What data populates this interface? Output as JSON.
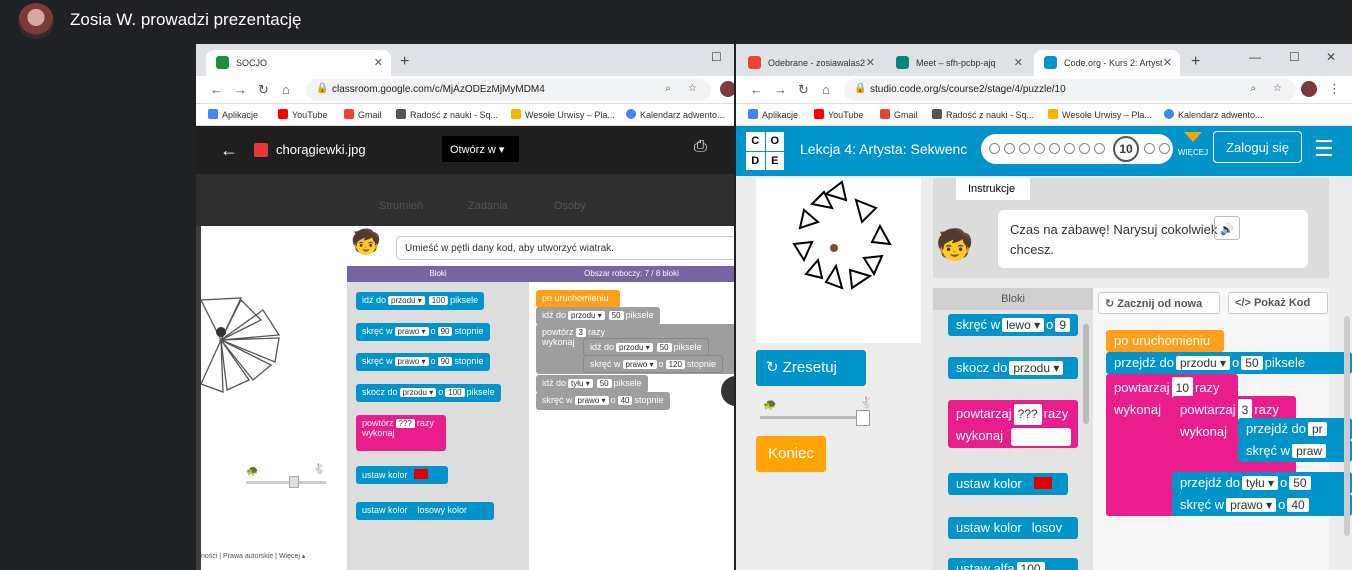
{
  "meet": {
    "presenter_text": "Zosia W. prowadzi prezentację"
  },
  "left_browser": {
    "tab_title": "SOCJO",
    "url": "classroom.google.com/c/MjAzODEzMjMyMDM4",
    "bookmarks": [
      "Aplikacje",
      "YouTube",
      "Gmail",
      "Radość z nauki - Sq...",
      "Wesołe Urwisy – Pla...",
      "Kalendarz adwento..."
    ],
    "viewer": {
      "filename": "chorągiewki.jpg",
      "open_with": "Otwórz w",
      "tabs": [
        "Strumień",
        "Zadania",
        "Osoby"
      ]
    },
    "instruction": "Umieść w pętli dany kod, aby utworzyć wiatrak.",
    "toolbox_header": "Bloki",
    "workspace_header": "Obszar roboczy: 7 / 8 bloki",
    "toolbox_blocks": [
      {
        "pre": "idź do",
        "s1": "przodu ▾",
        "s2": "100",
        "post": "piksele"
      },
      {
        "pre": "skręć w",
        "s1": "prawo ▾",
        "mid": "o",
        "s2": "90",
        "post": "stopnie"
      },
      {
        "pre": "skręć w",
        "s1": "prawo ▾",
        "mid": "o",
        "s2": "90",
        "post": "stopnie"
      },
      {
        "pre": "skocz do",
        "s1": "przodu ▾",
        "mid": "o",
        "s2": "100",
        "post": "piksele"
      }
    ],
    "repeat_block": {
      "pre": "powtórz",
      "s1": "???",
      "post": "razy",
      "do": "wykonaj"
    },
    "color_block": "ustaw kolor",
    "random_color_block": {
      "pre": "ustaw kolor",
      "s1": "losowy kolor"
    },
    "ws_start": "po uruchomieniu",
    "ws_b1": {
      "pre": "idź do",
      "s1": "przodu ▾",
      "s2": "50",
      "post": "piksele"
    },
    "ws_repeat": {
      "pre": "powtórz",
      "s1": "3",
      "post": "razy"
    },
    "ws_do": "wykonaj",
    "ws_b2": {
      "pre": "idź do",
      "s1": "przodu ▾",
      "s2": "50",
      "post": "piksele"
    },
    "ws_b3": {
      "pre": "skręć w",
      "s1": "prawo ▾",
      "mid": "o",
      "s2": "120",
      "post": "stopnie"
    },
    "ws_b4": {
      "pre": "idź do",
      "s1": "tyłu ▾",
      "s2": "50",
      "post": "piksele"
    },
    "ws_b5": {
      "pre": "skręć w",
      "s1": "prawo ▾",
      "mid": "o",
      "s2": "40",
      "post": "stopnie"
    },
    "footer": "ności | Prawa autorskie | Więcej ▴"
  },
  "right_browser": {
    "tabs": [
      "Odebrane - zosiawalas2",
      "Meet – sfh-pcbp-ajq",
      "Code.org - Kurs 2: Artyst"
    ],
    "url": "studio.code.org/s/course2/stage/4/puzzle/10",
    "bookmarks": [
      "Aplikacje",
      "YouTube",
      "Gmail",
      "Radość z nauki - Sq...",
      "Wesołe Urwisy – Pla...",
      "Kalendarz adwento..."
    ],
    "logo_letters": [
      "C",
      "O",
      "D",
      "E"
    ],
    "lesson_title": "Lekcja 4: Artysta: Sekwenc",
    "current_puzzle": "10",
    "more_label": "WIĘCEJ",
    "login_label": "Zaloguj się",
    "instructions_tab": "Instrukcje",
    "instruction_text": "Czas na zabawę! Narysuj cokolwiek chcesz.",
    "reset_label": "Zresetuj",
    "finish_label": "Koniec",
    "toolbox_header": "Bloki",
    "start_over": "Zacznij od nowa",
    "show_code": "Pokaż Kod",
    "tb_turn": {
      "pre": "skręć w",
      "s1": "lewo ▾",
      "mid": "o",
      "s2": "9"
    },
    "tb_jump": {
      "pre": "skocz do",
      "s1": "przodu ▾"
    },
    "tb_repeat": {
      "pre": "powtarzaj",
      "s1": "???",
      "post": "razy",
      "do": "wykonaj"
    },
    "tb_color": "ustaw kolor",
    "tb_color2": {
      "pre": "ustaw kolor",
      "s1": "losov"
    },
    "tb_alpha": {
      "pre": "ustaw alfa",
      "s1": "100"
    },
    "ws_start": "po uruchomieniu",
    "ws_b1": {
      "pre": "przejdź do",
      "s1": "przodu ▾",
      "mid": "o",
      "s2": "50",
      "post": "piksele"
    },
    "ws_r1": {
      "pre": "powtarzaj",
      "s1": "10",
      "post": "razy"
    },
    "ws_do1": "wykonaj",
    "ws_r2": {
      "pre": "powtarzaj",
      "s1": "3",
      "post": "razy"
    },
    "ws_do2": "wykonaj",
    "ws_b2": {
      "pre": "przejdź do",
      "s1": "pr"
    },
    "ws_b3": {
      "pre": "skręć w",
      "s1": "praw"
    },
    "ws_b4": {
      "pre": "przejdź do",
      "s1": "tyłu ▾",
      "mid": "o",
      "s2": "50"
    },
    "ws_b5": {
      "pre": "skręć w",
      "s1": "prawo ▾",
      "mid": "o",
      "s2": "40"
    }
  },
  "colors": {
    "codeorg_blue": "#0094ca",
    "block_pink": "#e91e8c",
    "block_orange": "#ff9f1a",
    "toolbox_purple": "#7665a0"
  }
}
